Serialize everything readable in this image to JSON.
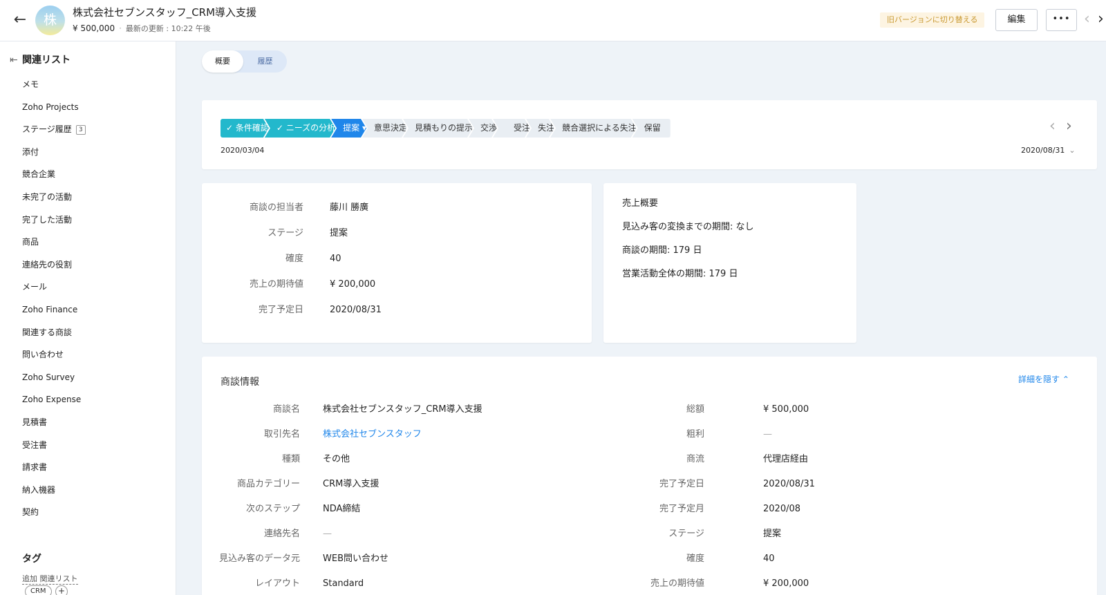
{
  "header": {
    "avatar_text": "株",
    "title": "株式会社セブンスタッフ_CRM導入支援",
    "amount": "¥ 500,000",
    "updated": "最新の更新 : 10:22 午後",
    "old_version_label": "旧バージョンに切り替える",
    "edit_label": "編集",
    "more_label": "•••",
    "back_icon": "←",
    "prev_icon": "‹",
    "next_icon": "›"
  },
  "sidebar": {
    "title": "関連リスト",
    "items": [
      {
        "label": "メモ"
      },
      {
        "label": "Zoho Projects"
      },
      {
        "label": "ステージ履歴",
        "badge": "3"
      },
      {
        "label": "添付"
      },
      {
        "label": "競合企業"
      },
      {
        "label": "未完了の活動"
      },
      {
        "label": "完了した活動"
      },
      {
        "label": "商品"
      },
      {
        "label": "連絡先の役割"
      },
      {
        "label": "メール"
      },
      {
        "label": "Zoho Finance"
      },
      {
        "label": "関連する商談"
      },
      {
        "label": "問い合わせ"
      },
      {
        "label": "Zoho Survey"
      },
      {
        "label": "Zoho Expense"
      },
      {
        "label": "見積書"
      },
      {
        "label": "受注書"
      },
      {
        "label": "請求書"
      },
      {
        "label": "納入機器"
      },
      {
        "label": "契約"
      }
    ],
    "add_related": "追加 関連リスト",
    "tags_title": "タグ",
    "tag": "CRM",
    "tag_add": "+"
  },
  "tabs": {
    "overview": "概要",
    "history": "履歴"
  },
  "stages": {
    "items": [
      {
        "label": "✓ 条件確認",
        "state": "done"
      },
      {
        "label": "✓ ニーズの分析",
        "state": "done"
      },
      {
        "label": "提案 ▾",
        "state": "current"
      },
      {
        "label": "意思決定",
        "state": "todo"
      },
      {
        "label": "見積もりの提示",
        "state": "todo"
      },
      {
        "label": "交渉",
        "state": "todo"
      },
      {
        "label": "受注",
        "state": "todo"
      },
      {
        "label": "失注",
        "state": "todo"
      },
      {
        "label": "競合選択による失注",
        "state": "todo"
      },
      {
        "label": "保留",
        "state": "todo"
      }
    ],
    "start_date": "2020/03/04",
    "end_date": "2020/08/31",
    "end_chevron": "⌄",
    "prev_icon": "‹",
    "next_icon": "›"
  },
  "key_fields": [
    {
      "label": "商談の担当者",
      "value": "藤川 勝廣"
    },
    {
      "label": "ステージ",
      "value": "提案"
    },
    {
      "label": "確度",
      "value": "40"
    },
    {
      "label": "売上の期待値",
      "value": "¥ 200,000"
    },
    {
      "label": "完了予定日",
      "value": "2020/08/31"
    }
  ],
  "summary": {
    "title": "売上概要",
    "lines": [
      "見込み客の変換までの期間: なし",
      "商談の期間: 179 日",
      "営業活動全体の期間: 179 日"
    ]
  },
  "details": {
    "title": "商談情報",
    "hide_label": "詳細を隠す ⌃",
    "left": [
      {
        "label": "商談名",
        "value": "株式会社セブンスタッフ_CRM導入支援"
      },
      {
        "label": "取引先名",
        "value": "株式会社セブンスタッフ",
        "link": true
      },
      {
        "label": "種類",
        "value": "その他"
      },
      {
        "label": "商品カテゴリー",
        "value": "CRM導入支援"
      },
      {
        "label": "次のステップ",
        "value": "NDA締結"
      },
      {
        "label": "連絡先名",
        "value": "—",
        "empty": true
      },
      {
        "label": "見込み客のデータ元",
        "value": "WEB問い合わせ"
      },
      {
        "label": "レイアウト",
        "value": "Standard"
      }
    ],
    "right": [
      {
        "label": "総額",
        "value": "¥ 500,000"
      },
      {
        "label": "粗利",
        "value": "—",
        "empty": true
      },
      {
        "label": "商流",
        "value": "代理店経由"
      },
      {
        "label": "完了予定日",
        "value": "2020/08/31"
      },
      {
        "label": "完了予定月",
        "value": "2020/08"
      },
      {
        "label": "ステージ",
        "value": "提案"
      },
      {
        "label": "確度",
        "value": "40"
      },
      {
        "label": "売上の期待値",
        "value": "¥ 200,000"
      }
    ]
  }
}
